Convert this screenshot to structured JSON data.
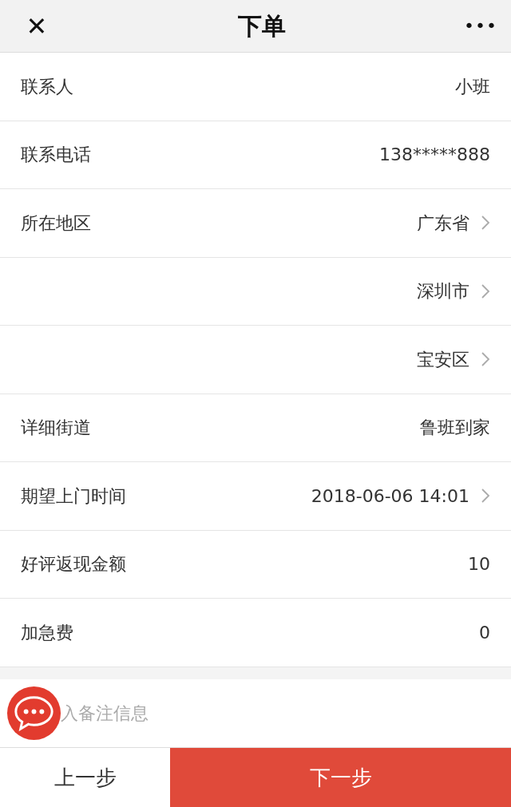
{
  "header": {
    "title": "下单",
    "close": "✕",
    "more": "•••"
  },
  "rows": [
    {
      "label": "联系人",
      "value": "小班",
      "kind": "text"
    },
    {
      "label": "联系电话",
      "value": "138*****888",
      "kind": "text"
    },
    {
      "label": "所在地区",
      "value": "广东省",
      "kind": "select"
    },
    {
      "value": "深圳市",
      "kind": "select"
    },
    {
      "value": "宝安区",
      "kind": "select"
    },
    {
      "label": "详细街道",
      "value": "鲁班到家",
      "kind": "text"
    },
    {
      "label": "期望上门时间",
      "value": "2018-06-06 14:01",
      "kind": "select"
    },
    {
      "label": "好评返现金额",
      "value": "10",
      "kind": "text"
    },
    {
      "label": "加急费",
      "value": "0",
      "kind": "text"
    }
  ],
  "remark": {
    "placeholder": "入备注信息"
  },
  "footer": {
    "prev": "上一步",
    "next": "下一步"
  }
}
